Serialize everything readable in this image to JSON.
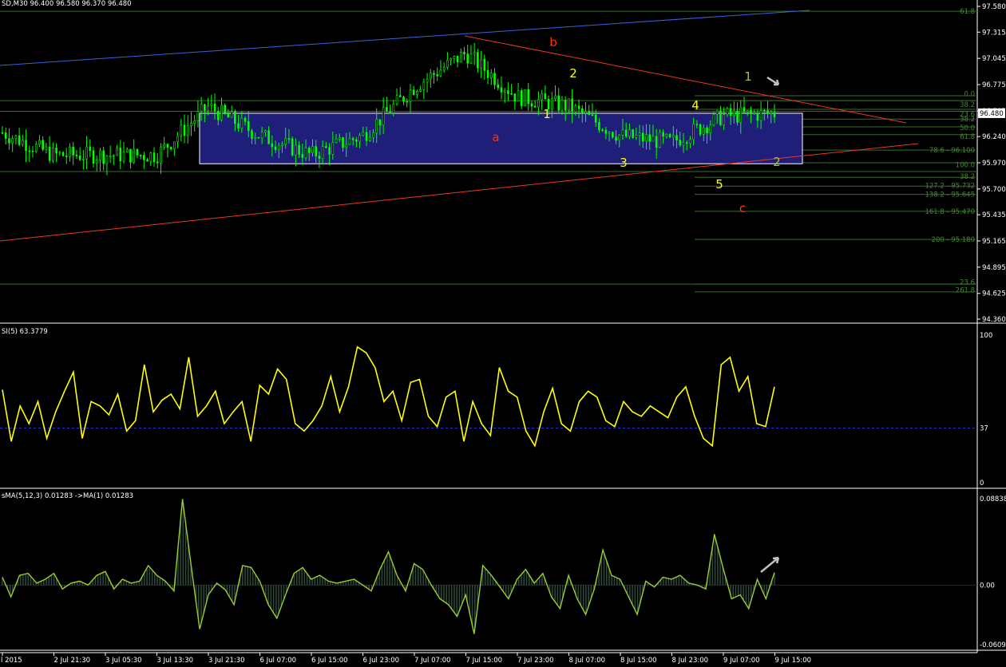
{
  "colors": {
    "background": "#000000",
    "axis": "#ffffff",
    "candle": "#00ff00",
    "fib": "#3a6b2a",
    "fib_text": "#3f8a2e",
    "channel_blue": "#3b63d9",
    "red_line": "#e8391d",
    "box_fill": "#1f1f7a",
    "rsi_line": "#ffff00",
    "rsi_level": "#3030c0",
    "osma_fill": "#2e4a3a",
    "osma_line": "#9acd32",
    "wave_yellow": "#ffff00",
    "wave_green": "#9acd32",
    "wave_red": "#ff3300",
    "arrow": "#c0c0c0"
  },
  "main_panel": {
    "header": "SD,M30  96.400 96.580 96.370 96.480",
    "price_label": "96.480",
    "y_ticks": [
      "97.580",
      "97.315",
      "97.045",
      "96.775",
      "96.505",
      "96.240",
      "95.970",
      "95.700",
      "95.435",
      "95.165",
      "94.895",
      "94.625",
      "94.360"
    ],
    "fib_labels": [
      "61.8",
      "0.0",
      "38.2",
      "23.6",
      "38.2",
      "50.0",
      "61.8",
      "78.6 - 96.100",
      "100.0",
      "38.2",
      "127.2 - 95.732",
      "138.2 - 95.645",
      "161.8 - 95.470",
      "200 - 95.180",
      "23.6",
      "261.8"
    ],
    "wave_labels": [
      {
        "text": "b",
        "color": "red"
      },
      {
        "text": "a",
        "color": "red"
      },
      {
        "text": "c",
        "color": "red"
      },
      {
        "text": "1",
        "color": "yellow"
      },
      {
        "text": "2",
        "color": "yellow"
      },
      {
        "text": "3",
        "color": "yellow"
      },
      {
        "text": "4",
        "color": "yellow"
      },
      {
        "text": "5",
        "color": "yellow"
      },
      {
        "text": "1",
        "color": "green"
      },
      {
        "text": "2",
        "color": "green"
      }
    ]
  },
  "rsi_panel": {
    "header": "SI(5) 63.3779",
    "y_ticks": [
      "100",
      "37",
      "0"
    ]
  },
  "osma_panel": {
    "header": "sMA(5,12,3) 0.01283  ->MA(1) 0.01283",
    "y_ticks": [
      "0.08838",
      "0.00",
      "-0.0609"
    ]
  },
  "x_axis": {
    "labels": [
      "l 2015",
      "2 Jul 21:30",
      "3 Jul 05:30",
      "3 Jul 13:30",
      "3 Jul 21:30",
      "6 Jul 07:00",
      "6 Jul 15:00",
      "6 Jul 23:00",
      "7 Jul 07:00",
      "7 Jul 15:00",
      "7 Jul 23:00",
      "8 Jul 07:00",
      "8 Jul 15:00",
      "8 Jul 23:00",
      "9 Jul 07:00",
      "9 Jul 15:00"
    ]
  },
  "chart_data": {
    "type": "candlestick",
    "instrument_timeframe": "M30",
    "ohlc_last": {
      "open": 96.4,
      "high": 96.58,
      "low": 96.37,
      "close": 96.48
    },
    "ylim": [
      94.36,
      97.58
    ],
    "price_anchor_points": [
      {
        "x": "l 2015",
        "y": 96.28
      },
      {
        "x": "2 Jul 21:30",
        "y": 96.05
      },
      {
        "x": "3 Jul 05:30",
        "y": 96.05
      },
      {
        "x": "3 Jul 13:30",
        "y": 96.05
      },
      {
        "x": "3 Jul 21:30",
        "y": 96.55
      },
      {
        "x": "6 Jul 07:00",
        "y": 96.25
      },
      {
        "x": "6 Jul 15:00",
        "y": 96.05
      },
      {
        "x": "6 Jul 23:00",
        "y": 96.25
      },
      {
        "x": "7 Jul 07:00",
        "y": 96.75
      },
      {
        "x": "7 Jul 15:00",
        "y": 97.1
      },
      {
        "x": "7 Jul 23:00",
        "y": 96.65
      },
      {
        "x": "8 Jul 07:00",
        "y": 96.55
      },
      {
        "x": "8 Jul 15:00",
        "y": 96.25
      },
      {
        "x": "8 Jul 23:00",
        "y": 96.18
      },
      {
        "x": "9 Jul 07:00",
        "y": 96.45
      },
      {
        "x": "9 Jul 15:00",
        "y": 96.48
      }
    ],
    "rsi": {
      "name": "SI(5)",
      "last": 63.3779,
      "ylim": [
        0,
        100
      ],
      "level": 37,
      "values": [
        63,
        28,
        52,
        40,
        55,
        30,
        48,
        62,
        75,
        30,
        55,
        52,
        46,
        60,
        35,
        42,
        80,
        48,
        56,
        60,
        50,
        85,
        45,
        52,
        62,
        40,
        48,
        55,
        28,
        66,
        60,
        77,
        70,
        40,
        35,
        42,
        52,
        72,
        48,
        65,
        92,
        88,
        78,
        55,
        62,
        42,
        68,
        70,
        45,
        38,
        58,
        62,
        28,
        55,
        40,
        32,
        78,
        62,
        58,
        35,
        25,
        48,
        64,
        40,
        35,
        55,
        62,
        58,
        42,
        38,
        55,
        48,
        45,
        52,
        48,
        44,
        58,
        65,
        45,
        30,
        25,
        80,
        85,
        62,
        72,
        40,
        38,
        65
      ]
    },
    "osma": {
      "name": "sMA(5,12,3)",
      "last": 0.01283,
      "ylim": [
        -0.0609,
        0.08838
      ],
      "values": [
        0.008,
        -0.012,
        0.01,
        0.012,
        0.002,
        0.006,
        0.012,
        -0.004,
        0.002,
        0.004,
        0.0,
        0.01,
        0.014,
        -0.004,
        0.006,
        0.002,
        0.004,
        0.02,
        0.01,
        0.004,
        -0.006,
        0.088,
        0.02,
        -0.045,
        -0.01,
        0.002,
        -0.005,
        -0.02,
        0.02,
        0.018,
        0.004,
        -0.02,
        -0.034,
        -0.01,
        0.012,
        0.018,
        0.006,
        0.01,
        0.004,
        0.002,
        0.004,
        0.006,
        0.0,
        -0.006,
        0.016,
        0.034,
        0.01,
        -0.006,
        0.022,
        0.016,
        0.0,
        -0.014,
        -0.02,
        -0.032,
        -0.01,
        -0.05,
        0.02,
        0.01,
        -0.002,
        -0.014,
        0.006,
        0.016,
        0.002,
        0.012,
        -0.012,
        -0.024,
        0.01,
        -0.014,
        -0.03,
        -0.004,
        0.036,
        0.01,
        0.006,
        -0.012,
        -0.03,
        0.004,
        -0.002,
        0.008,
        0.006,
        0.01,
        0.002,
        0.0,
        -0.004,
        0.052,
        0.018,
        -0.014,
        -0.01,
        -0.024,
        0.006,
        -0.014,
        0.01283
      ]
    }
  }
}
